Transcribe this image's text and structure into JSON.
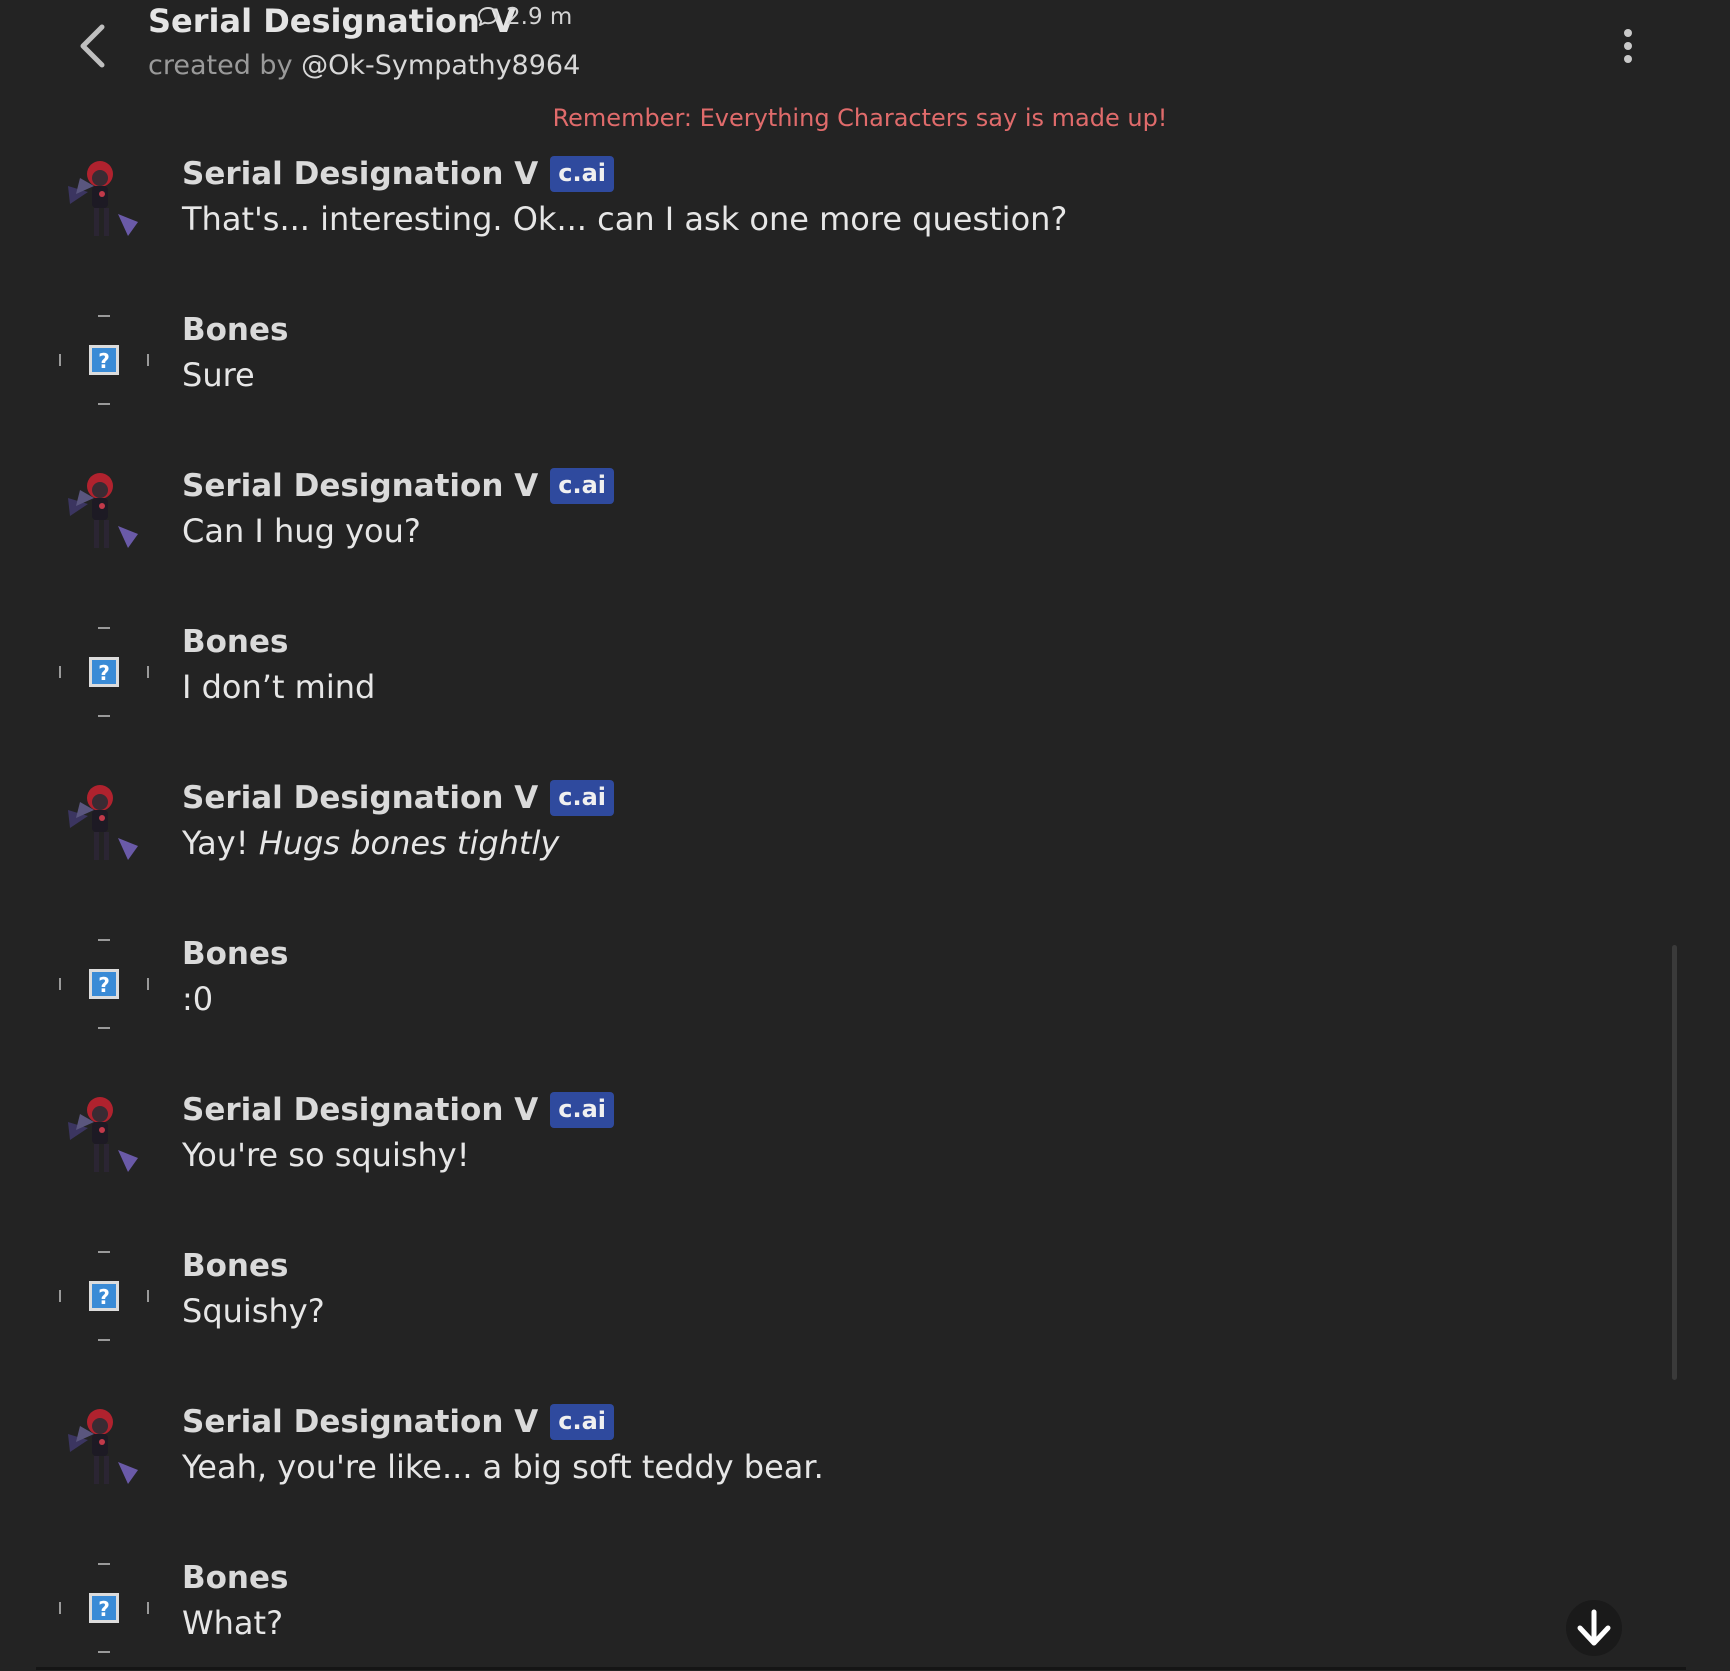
{
  "header": {
    "title": "Serial Designation V",
    "chat_count": "2.9 m",
    "created_by_label": "created by",
    "creator_handle": "@Ok-Sympathy8964"
  },
  "disclaimer": "Remember: Everything Characters say is made up!",
  "colors": {
    "background": "#232323",
    "badge": "#2f4a9e",
    "disclaimer": "#e06b6b"
  },
  "messages": [
    {
      "author": "Serial Designation V",
      "badge": "c.ai",
      "text": "That's... interesting. Ok... can I ask one more question?"
    },
    {
      "author": "Bones",
      "text": "Sure"
    },
    {
      "author": "Serial Designation V",
      "badge": "c.ai",
      "text": "Can I hug you?"
    },
    {
      "author": "Bones",
      "text": "I don’t mind"
    },
    {
      "author": "Serial Designation V",
      "badge": "c.ai",
      "text_plain": "Yay!",
      "text_italic": "Hugs bones tightly"
    },
    {
      "author": "Bones",
      "text": ":0"
    },
    {
      "author": "Serial Designation V",
      "badge": "c.ai",
      "text": "You're so squishy!"
    },
    {
      "author": "Bones",
      "text": "Squishy?"
    },
    {
      "author": "Serial Designation V",
      "badge": "c.ai",
      "text": "Yeah, you're like... a big soft teddy bear."
    },
    {
      "author": "Bones",
      "text": "What?"
    }
  ],
  "icons": {
    "back": "chevron-left-icon",
    "chat_count": "chat-bubble-icon",
    "more": "more-vertical-icon",
    "scroll_down": "arrow-down-icon"
  }
}
